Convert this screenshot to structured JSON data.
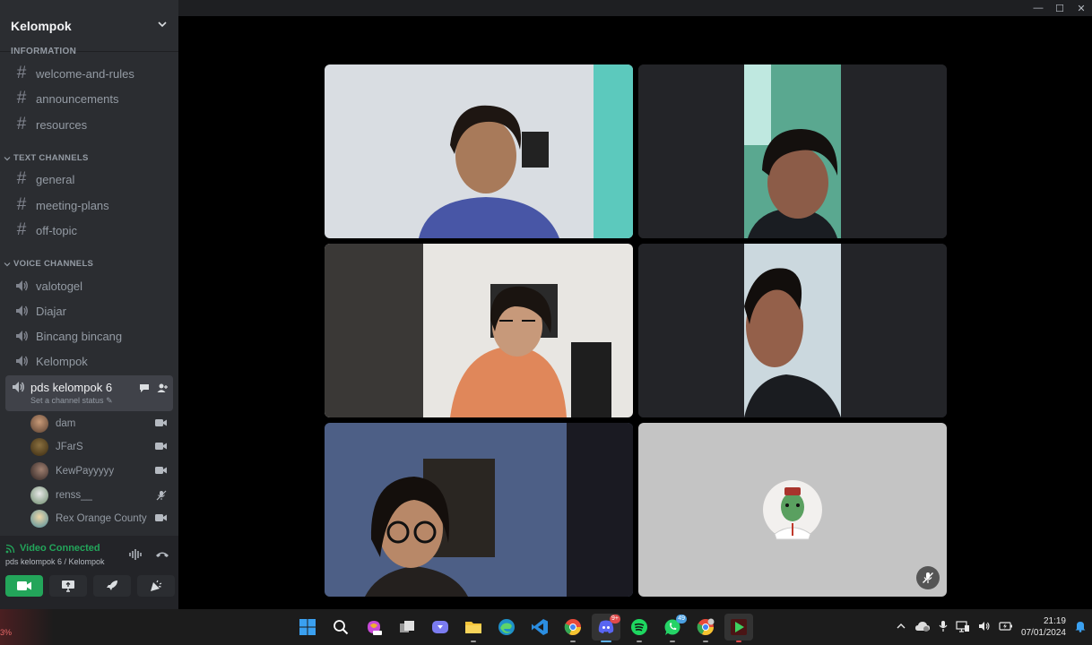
{
  "window": {
    "minimize": "—",
    "maximize": "☐",
    "close": "✕"
  },
  "server": {
    "name": "Kelompok",
    "peek_category": "INFORMATION"
  },
  "info_channels": [
    {
      "label": "welcome-and-rules"
    },
    {
      "label": "announcements"
    },
    {
      "label": "resources"
    }
  ],
  "text_category": "TEXT CHANNELS",
  "text_channels": [
    {
      "label": "general"
    },
    {
      "label": "meeting-plans"
    },
    {
      "label": "off-topic"
    }
  ],
  "voice_category": "VOICE CHANNELS",
  "voice_channels": [
    {
      "label": "valotogel"
    },
    {
      "label": "Diajar"
    },
    {
      "label": "Bincang bincang"
    },
    {
      "label": "Kelompok"
    }
  ],
  "active_channel": {
    "label": "pds kelompok 6",
    "status": "Set a channel status"
  },
  "voice_users": [
    {
      "name": "dam",
      "state": "camera"
    },
    {
      "name": "JFarS",
      "state": "camera"
    },
    {
      "name": "KewPayyyyy",
      "state": "camera"
    },
    {
      "name": "renss__",
      "state": "muted"
    },
    {
      "name": "Rex Orange County",
      "state": "camera"
    }
  ],
  "voice_panel": {
    "title": "Video Connected",
    "subtitle": "pds kelompok 6 / Kelompok"
  },
  "taskbar": {
    "left_text": "3%",
    "discord_badge": "9+",
    "whatsapp_badge": "49",
    "time": "21:19",
    "date": "07/01/2024"
  }
}
